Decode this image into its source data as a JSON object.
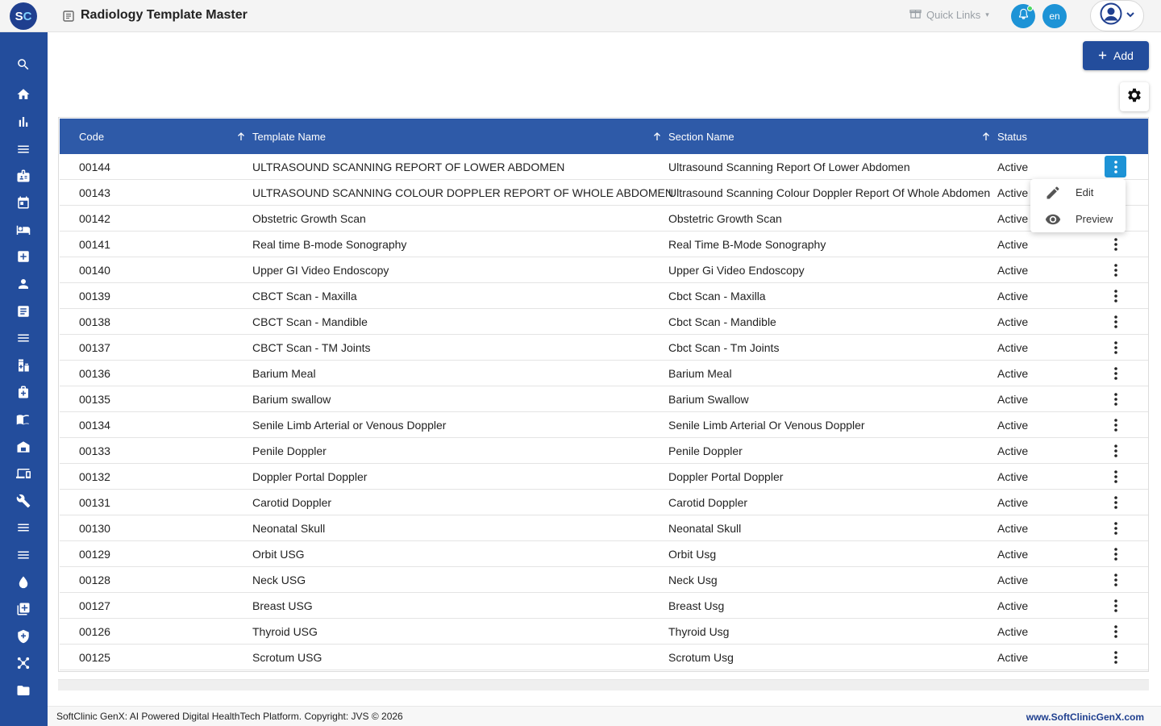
{
  "app": {
    "logo_s": "S",
    "logo_c": "C",
    "page_title": "Radiology Template Master",
    "quick_links": "Quick Links",
    "language": "en"
  },
  "sidebar": {
    "icons": [
      "search-icon",
      "home-icon",
      "bar-chart-icon",
      "menu-icon",
      "badge-icon",
      "calendar-icon",
      "bed-icon",
      "medical-plus-icon",
      "person-icon",
      "list-alt-icon",
      "menu-icon",
      "medication-icon",
      "pharmacy-icon",
      "book-icon",
      "store-icon",
      "devices-icon",
      "wrench-icon",
      "menu-icon",
      "menu-icon",
      "blood-drop-icon",
      "add-library-icon",
      "shield-icon",
      "network-icon",
      "folder-icon"
    ]
  },
  "toolbar": {
    "add_label": "Add"
  },
  "table": {
    "headers": {
      "code": "Code",
      "template_name": "Template Name",
      "section_name": "Section Name",
      "status": "Status"
    },
    "rows": [
      {
        "code": "00144",
        "name": "ULTRASOUND SCANNING REPORT OF LOWER ABDOMEN",
        "section": "Ultrasound Scanning Report Of Lower Abdomen",
        "status": "Active"
      },
      {
        "code": "00143",
        "name": "ULTRASOUND SCANNING COLOUR DOPPLER REPORT OF WHOLE ABDOMEN",
        "section": "Ultrasound Scanning Colour Doppler Report Of Whole Abdomen",
        "status": "Active"
      },
      {
        "code": "00142",
        "name": "Obstetric Growth Scan",
        "section": "Obstetric Growth Scan",
        "status": "Active"
      },
      {
        "code": "00141",
        "name": "Real time B-mode Sonography",
        "section": "Real Time B-Mode Sonography",
        "status": "Active"
      },
      {
        "code": "00140",
        "name": "Upper GI Video Endoscopy",
        "section": "Upper Gi Video Endoscopy",
        "status": "Active"
      },
      {
        "code": "00139",
        "name": "CBCT Scan - Maxilla",
        "section": "Cbct Scan - Maxilla",
        "status": "Active"
      },
      {
        "code": "00138",
        "name": "CBCT Scan - Mandible",
        "section": "Cbct Scan - Mandible",
        "status": "Active"
      },
      {
        "code": "00137",
        "name": "CBCT Scan - TM Joints",
        "section": "Cbct Scan - Tm Joints",
        "status": "Active"
      },
      {
        "code": "00136",
        "name": "Barium Meal",
        "section": "Barium Meal",
        "status": "Active"
      },
      {
        "code": "00135",
        "name": "Barium swallow",
        "section": "Barium Swallow",
        "status": "Active"
      },
      {
        "code": "00134",
        "name": "Senile Limb Arterial or Venous Doppler",
        "section": "Senile Limb Arterial Or Venous Doppler",
        "status": "Active"
      },
      {
        "code": "00133",
        "name": "Penile Doppler",
        "section": "Penile Doppler",
        "status": "Active"
      },
      {
        "code": "00132",
        "name": "Doppler Portal Doppler",
        "section": "Doppler Portal Doppler",
        "status": "Active"
      },
      {
        "code": "00131",
        "name": "Carotid Doppler",
        "section": "Carotid Doppler",
        "status": "Active"
      },
      {
        "code": "00130",
        "name": "Neonatal Skull",
        "section": "Neonatal Skull",
        "status": "Active"
      },
      {
        "code": "00129",
        "name": "Orbit USG",
        "section": "Orbit Usg",
        "status": "Active"
      },
      {
        "code": "00128",
        "name": "Neck USG",
        "section": "Neck Usg",
        "status": "Active"
      },
      {
        "code": "00127",
        "name": "Breast USG",
        "section": "Breast Usg",
        "status": "Active"
      },
      {
        "code": "00126",
        "name": "Thyroid USG",
        "section": "Thyroid Usg",
        "status": "Active"
      },
      {
        "code": "00125",
        "name": "Scrotum USG",
        "section": "Scrotum Usg",
        "status": "Active"
      }
    ]
  },
  "row_menu": {
    "edit_label": "Edit",
    "preview_label": "Preview"
  },
  "footer": {
    "copyright": "SoftClinic GenX: AI Powered Digital HealthTech Platform. Copyright: JVS © 2026",
    "website": "www.SoftClinicGenX.com"
  },
  "colors": {
    "primary": "#234d9c",
    "header": "#2e5aa8",
    "accent": "#1d93d6"
  }
}
